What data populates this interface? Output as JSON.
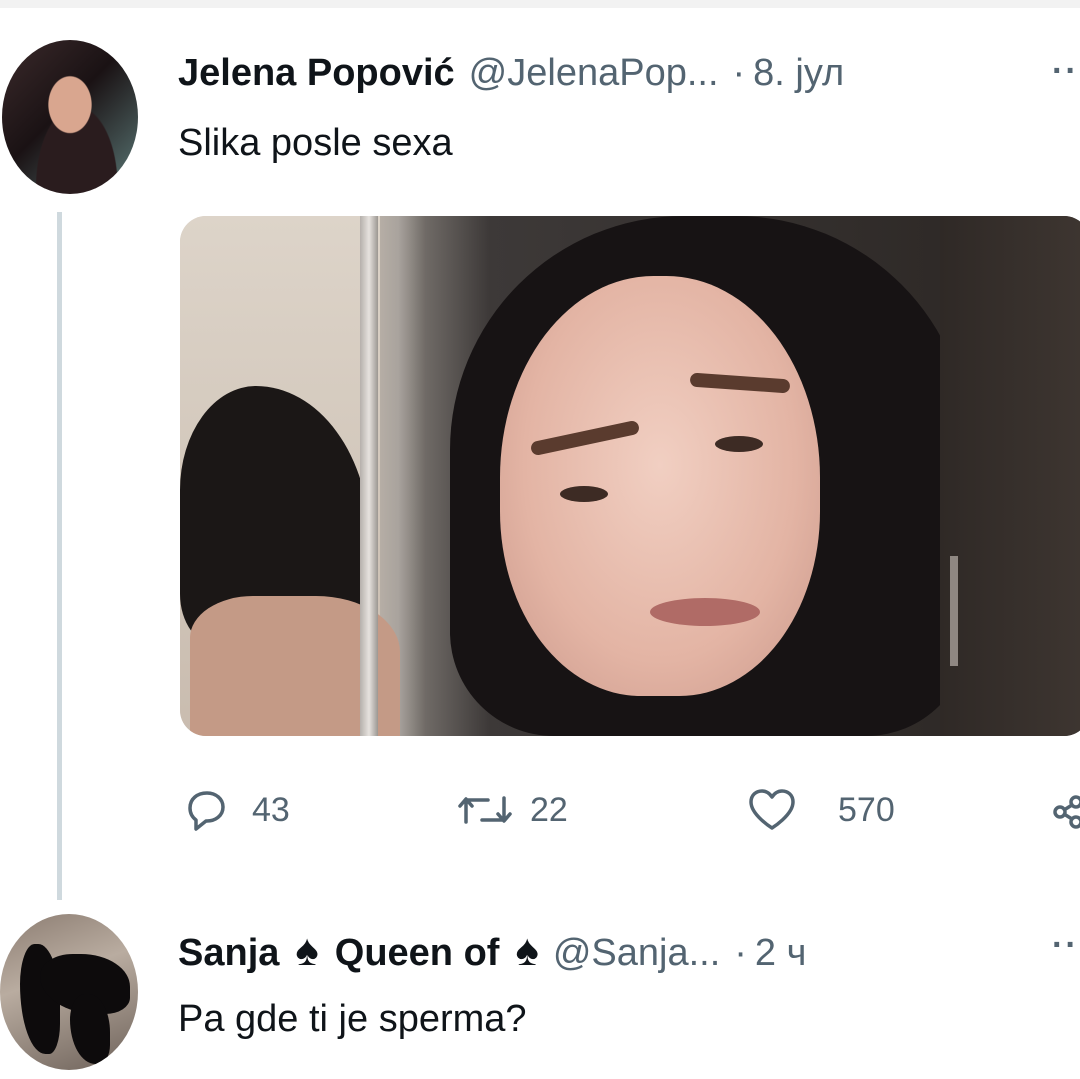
{
  "tweet": {
    "author_name": "Jelena Popović",
    "author_handle": "@JelenaPop...",
    "separator": "·",
    "timestamp": "8. јул",
    "more_label": "··",
    "text": "Slika posle sexa",
    "actions": {
      "replies": "43",
      "retweets": "22",
      "likes": "570"
    }
  },
  "reply": {
    "author_name_part1": "Sanja",
    "author_name_part2": "Queen of",
    "spade_icon": "♠",
    "author_handle": "@Sanja...",
    "separator": "·",
    "timestamp": "2 ч",
    "more_label": "··",
    "text": "Pa gde ti je sperma?"
  },
  "icons": {
    "reply": "reply-icon",
    "retweet": "retweet-icon",
    "like": "heart-icon",
    "share": "share-icon"
  },
  "colors": {
    "text_primary": "#0f1419",
    "text_secondary": "#536471",
    "thread_line": "#cfd9de"
  }
}
